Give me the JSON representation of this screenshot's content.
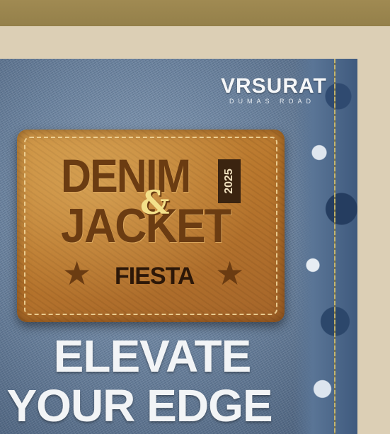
{
  "logo": {
    "main": "VRSURAT",
    "sub": "DUMAS ROAD"
  },
  "patch": {
    "word1": "DENIM",
    "ampersand": "&",
    "word2": "JACKET",
    "year": "2025",
    "subtitle": "FIESTA",
    "star_glyph": "★"
  },
  "tagline": {
    "line1": "ELEVATE",
    "line2": "YOUR EDGE"
  },
  "colors": {
    "topbar": "#a08a52",
    "background": "#dccfb5",
    "denim": "#6f86a1",
    "leather": "#b9772d"
  }
}
